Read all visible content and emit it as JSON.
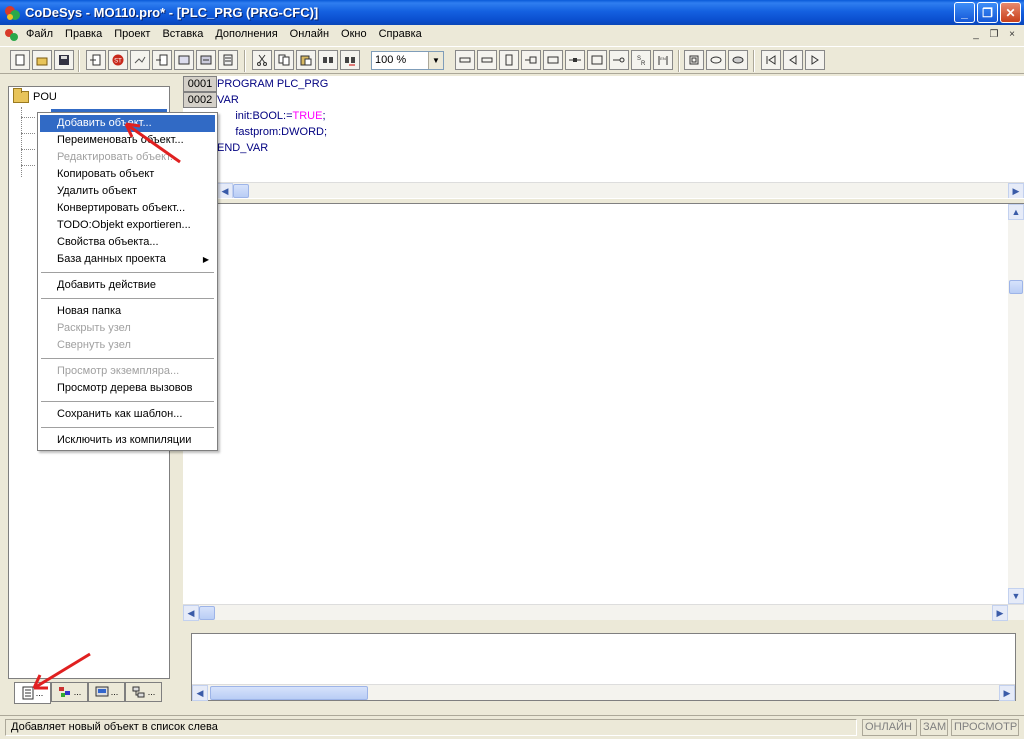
{
  "window": {
    "title": "CoDeSys - MO110.pro* - [PLC_PRG (PRG-CFC)]",
    "minimize": "_",
    "maximize": "❐",
    "close": "✕"
  },
  "menubar": {
    "items": [
      "Файл",
      "Правка",
      "Проект",
      "Вставка",
      "Дополнения",
      "Онлайн",
      "Окно",
      "Справка"
    ],
    "mdi_minimize": "_",
    "mdi_restore": "❐",
    "mdi_close": "×"
  },
  "toolbar": {
    "zoom_value": "100 %"
  },
  "tree": {
    "root_label": "POU"
  },
  "declaration": {
    "line_numbers": [
      "0001",
      "0002"
    ],
    "lines": [
      {
        "kw": "PROGRAM",
        "rest": " PLC_PRG"
      },
      {
        "kw": "VAR",
        "rest": ""
      },
      {
        "kw": "",
        "rest": "      init:BOOL:=",
        "tv": "TRUE",
        "end": ";"
      },
      {
        "kw": "",
        "rest": "      fastprom:DWORD;"
      },
      {
        "kw": "END_VAR",
        "rest": ""
      }
    ]
  },
  "context_menu": {
    "items": [
      {
        "label": "Добавить объект...",
        "state": "highlighted"
      },
      {
        "label": "Переименовать объект...",
        "state": "enabled"
      },
      {
        "label": "Редактировать объект...",
        "state": "disabled"
      },
      {
        "label": "Копировать объект",
        "state": "enabled"
      },
      {
        "label": "Удалить объект",
        "state": "enabled"
      },
      {
        "label": "Конвертировать объект...",
        "state": "enabled"
      },
      {
        "label": "TODO:Objekt exportieren...",
        "state": "enabled"
      },
      {
        "label": "Свойства объекта...",
        "state": "enabled"
      },
      {
        "label": "База данных проекта",
        "state": "enabled",
        "submenu": "▶"
      },
      {
        "sep": true
      },
      {
        "label": "Добавить действие",
        "state": "enabled"
      },
      {
        "sep": true
      },
      {
        "label": "Новая папка",
        "state": "enabled"
      },
      {
        "label": "Раскрыть узел",
        "state": "disabled"
      },
      {
        "label": "Свернуть узел",
        "state": "disabled"
      },
      {
        "sep": true
      },
      {
        "label": "Просмотр экземпляра...",
        "state": "disabled"
      },
      {
        "label": "Просмотр дерева вызовов",
        "state": "enabled"
      },
      {
        "sep": true
      },
      {
        "label": "Сохранить как шаблон...",
        "state": "enabled"
      },
      {
        "sep": true
      },
      {
        "label": "Исключить из компиляции",
        "state": "enabled"
      }
    ]
  },
  "left_tabs": [
    "...",
    "...",
    "...",
    "..."
  ],
  "statusbar": {
    "text": "Добавляет новый объект в список слева",
    "online": "ОНЛАЙН",
    "zam": "ЗАМ",
    "view": "ПРОСМОТР"
  },
  "colors": {
    "annotation_arrow": "#e02020",
    "selection": "#316ac5"
  }
}
